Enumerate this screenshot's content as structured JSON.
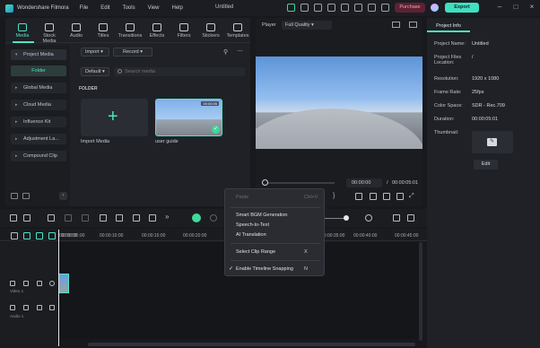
{
  "app": {
    "name": "Wondershare Filmora",
    "doc_title": "Untitled"
  },
  "menu": [
    "File",
    "Edit",
    "Tools",
    "View",
    "Help"
  ],
  "header": {
    "purchase": "Purchase",
    "export": "Export"
  },
  "media_tabs": [
    "Media",
    "Stock Media",
    "Audio",
    "Titles",
    "Transitions",
    "Effects",
    "Filters",
    "Stickers",
    "Templates"
  ],
  "sidebar": {
    "project_media": "Project Media",
    "folder": "Folder",
    "items": [
      "Global Media",
      "Cloud Media",
      "Influence Kit",
      "Adjustment La...",
      "Compound Clip"
    ]
  },
  "media": {
    "import_btn": "Import",
    "record_btn": "Record",
    "sort": "Default",
    "search_placeholder": "Search media",
    "folder_label": "FOLDER",
    "import_label": "Import Media",
    "clip_label": "user guide",
    "clip_duration": "00:00:05"
  },
  "player": {
    "label": "Player",
    "quality": "Full Quality",
    "current": "00:00:00",
    "separator": "/",
    "total": "00:00:05:01"
  },
  "project_info": {
    "tab": "Project Info",
    "rows": [
      {
        "label": "Project Name:",
        "value": "Untitled"
      },
      {
        "label": "Project Files Location:",
        "value": "/"
      },
      {
        "label": "Resolution:",
        "value": "1920 x 1080"
      },
      {
        "label": "Frame Rate:",
        "value": "25fps"
      },
      {
        "label": "Color Space:",
        "value": "SDR - Rec.709"
      },
      {
        "label": "Duration:",
        "value": "00:00:05:01"
      },
      {
        "label": "Thumbnail:",
        "value": ""
      }
    ],
    "edit_btn": "Edit"
  },
  "timeline": {
    "ruler": [
      "00:00:00",
      "00:00:05:00",
      "00:00:10:00",
      "00:00:15:00",
      "00:00:20:00",
      "00:00:35:00",
      "00:00:40:00",
      "00:00:45:00"
    ],
    "video_track": "Video 1",
    "audio_track": "Audio 1"
  },
  "context_menu": {
    "paste": "Paste",
    "paste_key": "Ctrl+V",
    "smart_bgm": "Smart BGM Generation",
    "speech_to_text": "Speech-to-Text",
    "ai_translation": "AI Translation",
    "select_clip_range": "Select Clip Range",
    "select_clip_range_key": "X",
    "enable_snapping": "Enable Timeline Snapping",
    "enable_snapping_key": "N"
  }
}
